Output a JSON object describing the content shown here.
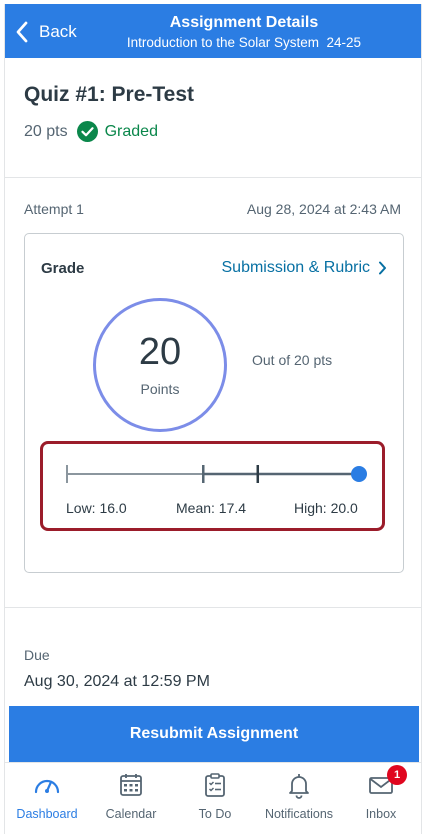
{
  "header": {
    "back_label": "Back",
    "title": "Assignment Details",
    "subtitle": "Introduction to the Solar System  24-25"
  },
  "assignment": {
    "title": "Quiz #1: Pre-Test",
    "points": "20 pts",
    "status": "Graded"
  },
  "attempt": {
    "label": "Attempt 1",
    "date": "Aug 28, 2024 at 2:43 AM"
  },
  "grade": {
    "label": "Grade",
    "link_label": "Submission & Rubric",
    "score": "20",
    "score_unit": "Points",
    "out_of": "Out of 20 pts",
    "stats": {
      "low_label": "Low: 16.0",
      "mean_label": "Mean: 17.4",
      "high_label": "High: 20.0",
      "low": 16.0,
      "mean": 17.4,
      "high": 20.0,
      "score": 20,
      "min": 0,
      "max": 20
    }
  },
  "due": {
    "label": "Due",
    "value": "Aug 30, 2024 at 12:59 PM"
  },
  "resubmit_label": "Resubmit Assignment",
  "tabs": [
    {
      "label": "Dashboard",
      "icon": "dashboard-icon",
      "active": true
    },
    {
      "label": "Calendar",
      "icon": "calendar-icon"
    },
    {
      "label": "To Do",
      "icon": "todo-icon"
    },
    {
      "label": "Notifications",
      "icon": "bell-icon"
    },
    {
      "label": "Inbox",
      "icon": "mail-icon",
      "badge": "1"
    }
  ],
  "colors": {
    "brand_blue": "#2b7de3",
    "link_blue": "#0770a3",
    "graded_green": "#0b874b",
    "highlight_red": "#9b1c2a",
    "badge_red": "#e0061f"
  }
}
